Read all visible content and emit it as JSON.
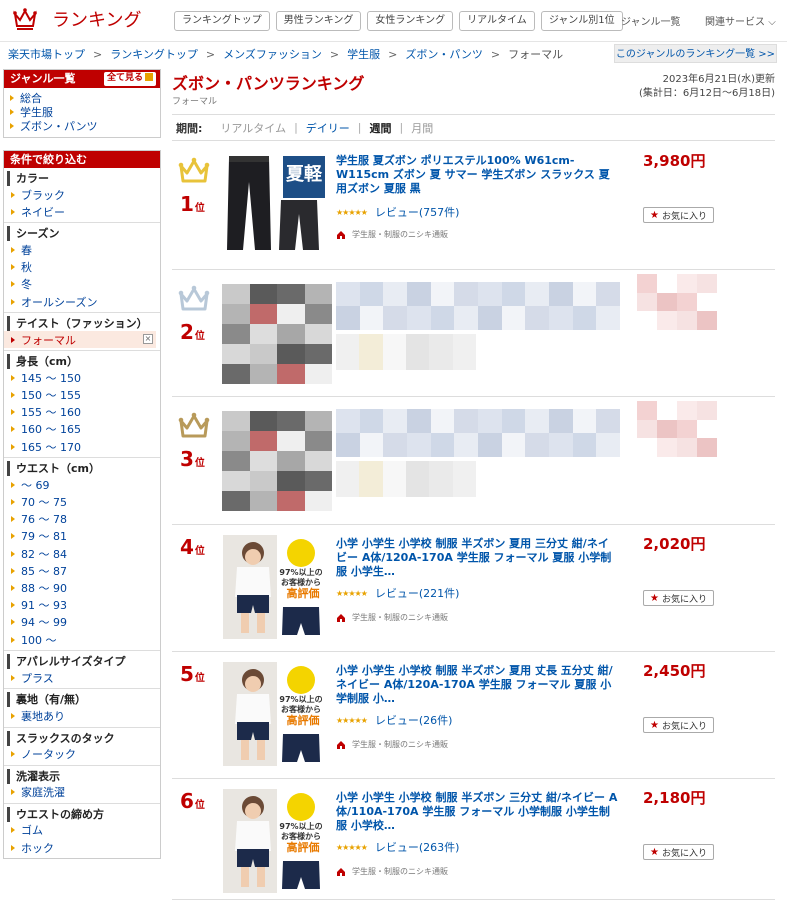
{
  "header": {
    "logo_text": "ランキング",
    "nav": [
      "ランキングトップ",
      "男性ランキング",
      "女性ランキング",
      "リアルタイム",
      "ジャンル別1位"
    ],
    "genre_list_link": "ジャンル一覧",
    "related_services": "関連サービス"
  },
  "breadcrumb": [
    "楽天市場トップ",
    "ランキングトップ",
    "メンズファッション",
    "学生服",
    "ズボン・パンツ",
    "フォーマル"
  ],
  "genre_ranking_list_link": "このジャンルのランキング一覧 >>",
  "sidebar": {
    "genre_title": "ジャンル一覧",
    "see_all": "全て見る",
    "genres": [
      "総合",
      "学生服",
      "ズボン・パンツ"
    ],
    "filter_title": "条件で絞り込む",
    "filters": [
      {
        "title": "カラー",
        "items": [
          "ブラック",
          "ネイビー"
        ]
      },
      {
        "title": "シーズン",
        "items": [
          "春",
          "秋",
          "冬",
          "オールシーズン"
        ]
      },
      {
        "title": "テイスト（ファッション）",
        "items": [
          "フォーマル"
        ],
        "selected": "フォーマル"
      },
      {
        "title": "身長（cm）",
        "items": [
          "145 ～ 150",
          "150 ～ 155",
          "155 ～ 160",
          "160 ～ 165",
          "165 ～ 170"
        ]
      },
      {
        "title": "ウエスト（cm）",
        "items": [
          "～ 69",
          "70 ～ 75",
          "76 ～ 78",
          "79 ～ 81",
          "82 ～ 84",
          "85 ～ 87",
          "88 ～ 90",
          "91 ～ 93",
          "94 ～ 99",
          "100 ～"
        ]
      },
      {
        "title": "アパレルサイズタイプ",
        "items": [
          "プラス"
        ]
      },
      {
        "title": "裏地（有/無）",
        "items": [
          "裏地あり"
        ]
      },
      {
        "title": "スラックスのタック",
        "items": [
          "ノータック"
        ]
      },
      {
        "title": "洗濯表示",
        "items": [
          "家庭洗濯"
        ]
      },
      {
        "title": "ウエストの締め方",
        "items": [
          "ゴム",
          "ホック"
        ]
      }
    ]
  },
  "main": {
    "title": "ズボン・パンツランキング",
    "subtitle": "フォーマル",
    "updated": "2023年6月21日(水)更新",
    "period_range": "(集計日：6月12日～6月18日)",
    "period_label": "期間:",
    "periods": [
      "リアルタイム",
      "デイリー",
      "週間",
      "月間"
    ],
    "current_period": "週間",
    "rank_suffix": "位",
    "items": [
      {
        "rank": "1",
        "title": "学生服 夏ズボン ポリエステル100% W61cm-W115cm ズボン 夏 サマー 学生ズボン スラックス 夏用ズボン 夏服 黒",
        "stars": "★★★★★",
        "reviews": "レビュー(757件)",
        "shop": "学生服・制服のニシキ通販",
        "price": "3,980円",
        "fav": "お気に入り",
        "crown_color": "#e8c33a",
        "badge": "夏軽"
      },
      {
        "rank": "2",
        "crown_color": "#b8c8d8"
      },
      {
        "rank": "3",
        "crown_color": "#b89a5a"
      },
      {
        "rank": "4",
        "title": "小学 小学生 小学校 制服 半ズボン 夏用 三分丈 紺/ネイビー A体/120A-170A 学生服 フォーマル 夏服 小学制服 小学生…",
        "stars": "★★★★★",
        "reviews": "レビュー(221件)",
        "shop": "学生服・制服のニシキ通販",
        "price": "2,020円",
        "fav": "お気に入り",
        "badge_top": "97%以上の",
        "badge_mid": "お客様から",
        "badge_bottom": "高評価"
      },
      {
        "rank": "5",
        "title": "小学 小学生 小学校 制服 半ズボン 夏用 丈長 五分丈 紺/ネイビー A体/120A-170A 学生服 フォーマル 夏服 小学制服 小…",
        "stars": "★★★★★",
        "reviews": "レビュー(26件)",
        "shop": "学生服・制服のニシキ通販",
        "price": "2,450円",
        "fav": "お気に入り",
        "badge_top": "97%以上の",
        "badge_mid": "お客様から",
        "badge_bottom": "高評価"
      },
      {
        "rank": "6",
        "title": "小学 小学生 小学校 制服 半ズボン 三分丈 紺/ネイビー A体/110A-170A 学生服 フォーマル 小学制服 小学生制服 小学校…",
        "stars": "★★★★★",
        "reviews": "レビュー(263件)",
        "shop": "学生服・制服のニシキ通販",
        "price": "2,180円",
        "fav": "お気に入り",
        "badge_top": "97%以上の",
        "badge_mid": "お客様から",
        "badge_bottom": "高評価"
      }
    ]
  },
  "colors": {
    "brand": "#bf0000",
    "link": "#0055aa",
    "accent": "#e8a200"
  }
}
